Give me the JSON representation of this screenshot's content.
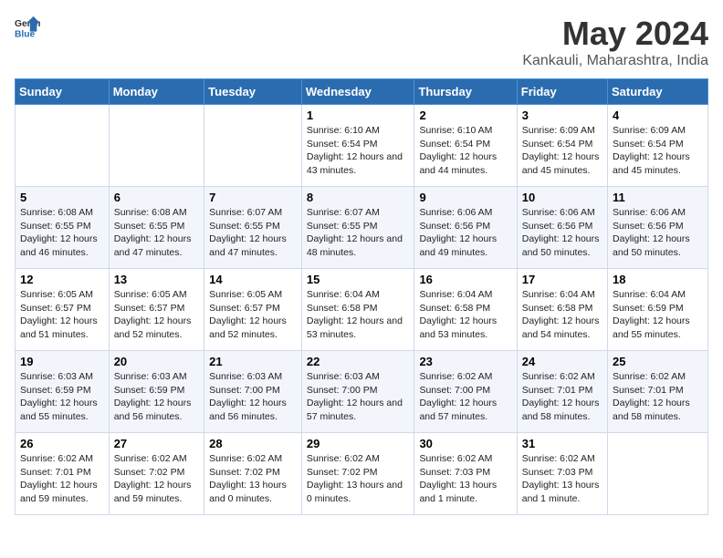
{
  "logo": {
    "general": "General",
    "blue": "Blue"
  },
  "title": "May 2024",
  "subtitle": "Kankauli, Maharashtra, India",
  "headers": [
    "Sunday",
    "Monday",
    "Tuesday",
    "Wednesday",
    "Thursday",
    "Friday",
    "Saturday"
  ],
  "weeks": [
    [
      {
        "day": "",
        "info": ""
      },
      {
        "day": "",
        "info": ""
      },
      {
        "day": "",
        "info": ""
      },
      {
        "day": "1",
        "info": "Sunrise: 6:10 AM\nSunset: 6:54 PM\nDaylight: 12 hours\nand 43 minutes."
      },
      {
        "day": "2",
        "info": "Sunrise: 6:10 AM\nSunset: 6:54 PM\nDaylight: 12 hours\nand 44 minutes."
      },
      {
        "day": "3",
        "info": "Sunrise: 6:09 AM\nSunset: 6:54 PM\nDaylight: 12 hours\nand 45 minutes."
      },
      {
        "day": "4",
        "info": "Sunrise: 6:09 AM\nSunset: 6:54 PM\nDaylight: 12 hours\nand 45 minutes."
      }
    ],
    [
      {
        "day": "5",
        "info": "Sunrise: 6:08 AM\nSunset: 6:55 PM\nDaylight: 12 hours\nand 46 minutes."
      },
      {
        "day": "6",
        "info": "Sunrise: 6:08 AM\nSunset: 6:55 PM\nDaylight: 12 hours\nand 47 minutes."
      },
      {
        "day": "7",
        "info": "Sunrise: 6:07 AM\nSunset: 6:55 PM\nDaylight: 12 hours\nand 47 minutes."
      },
      {
        "day": "8",
        "info": "Sunrise: 6:07 AM\nSunset: 6:55 PM\nDaylight: 12 hours\nand 48 minutes."
      },
      {
        "day": "9",
        "info": "Sunrise: 6:06 AM\nSunset: 6:56 PM\nDaylight: 12 hours\nand 49 minutes."
      },
      {
        "day": "10",
        "info": "Sunrise: 6:06 AM\nSunset: 6:56 PM\nDaylight: 12 hours\nand 50 minutes."
      },
      {
        "day": "11",
        "info": "Sunrise: 6:06 AM\nSunset: 6:56 PM\nDaylight: 12 hours\nand 50 minutes."
      }
    ],
    [
      {
        "day": "12",
        "info": "Sunrise: 6:05 AM\nSunset: 6:57 PM\nDaylight: 12 hours\nand 51 minutes."
      },
      {
        "day": "13",
        "info": "Sunrise: 6:05 AM\nSunset: 6:57 PM\nDaylight: 12 hours\nand 52 minutes."
      },
      {
        "day": "14",
        "info": "Sunrise: 6:05 AM\nSunset: 6:57 PM\nDaylight: 12 hours\nand 52 minutes."
      },
      {
        "day": "15",
        "info": "Sunrise: 6:04 AM\nSunset: 6:58 PM\nDaylight: 12 hours\nand 53 minutes."
      },
      {
        "day": "16",
        "info": "Sunrise: 6:04 AM\nSunset: 6:58 PM\nDaylight: 12 hours\nand 53 minutes."
      },
      {
        "day": "17",
        "info": "Sunrise: 6:04 AM\nSunset: 6:58 PM\nDaylight: 12 hours\nand 54 minutes."
      },
      {
        "day": "18",
        "info": "Sunrise: 6:04 AM\nSunset: 6:59 PM\nDaylight: 12 hours\nand 55 minutes."
      }
    ],
    [
      {
        "day": "19",
        "info": "Sunrise: 6:03 AM\nSunset: 6:59 PM\nDaylight: 12 hours\nand 55 minutes."
      },
      {
        "day": "20",
        "info": "Sunrise: 6:03 AM\nSunset: 6:59 PM\nDaylight: 12 hours\nand 56 minutes."
      },
      {
        "day": "21",
        "info": "Sunrise: 6:03 AM\nSunset: 7:00 PM\nDaylight: 12 hours\nand 56 minutes."
      },
      {
        "day": "22",
        "info": "Sunrise: 6:03 AM\nSunset: 7:00 PM\nDaylight: 12 hours\nand 57 minutes."
      },
      {
        "day": "23",
        "info": "Sunrise: 6:02 AM\nSunset: 7:00 PM\nDaylight: 12 hours\nand 57 minutes."
      },
      {
        "day": "24",
        "info": "Sunrise: 6:02 AM\nSunset: 7:01 PM\nDaylight: 12 hours\nand 58 minutes."
      },
      {
        "day": "25",
        "info": "Sunrise: 6:02 AM\nSunset: 7:01 PM\nDaylight: 12 hours\nand 58 minutes."
      }
    ],
    [
      {
        "day": "26",
        "info": "Sunrise: 6:02 AM\nSunset: 7:01 PM\nDaylight: 12 hours\nand 59 minutes."
      },
      {
        "day": "27",
        "info": "Sunrise: 6:02 AM\nSunset: 7:02 PM\nDaylight: 12 hours\nand 59 minutes."
      },
      {
        "day": "28",
        "info": "Sunrise: 6:02 AM\nSunset: 7:02 PM\nDaylight: 13 hours\nand 0 minutes."
      },
      {
        "day": "29",
        "info": "Sunrise: 6:02 AM\nSunset: 7:02 PM\nDaylight: 13 hours\nand 0 minutes."
      },
      {
        "day": "30",
        "info": "Sunrise: 6:02 AM\nSunset: 7:03 PM\nDaylight: 13 hours\nand 1 minute."
      },
      {
        "day": "31",
        "info": "Sunrise: 6:02 AM\nSunset: 7:03 PM\nDaylight: 13 hours\nand 1 minute."
      },
      {
        "day": "",
        "info": ""
      }
    ]
  ]
}
